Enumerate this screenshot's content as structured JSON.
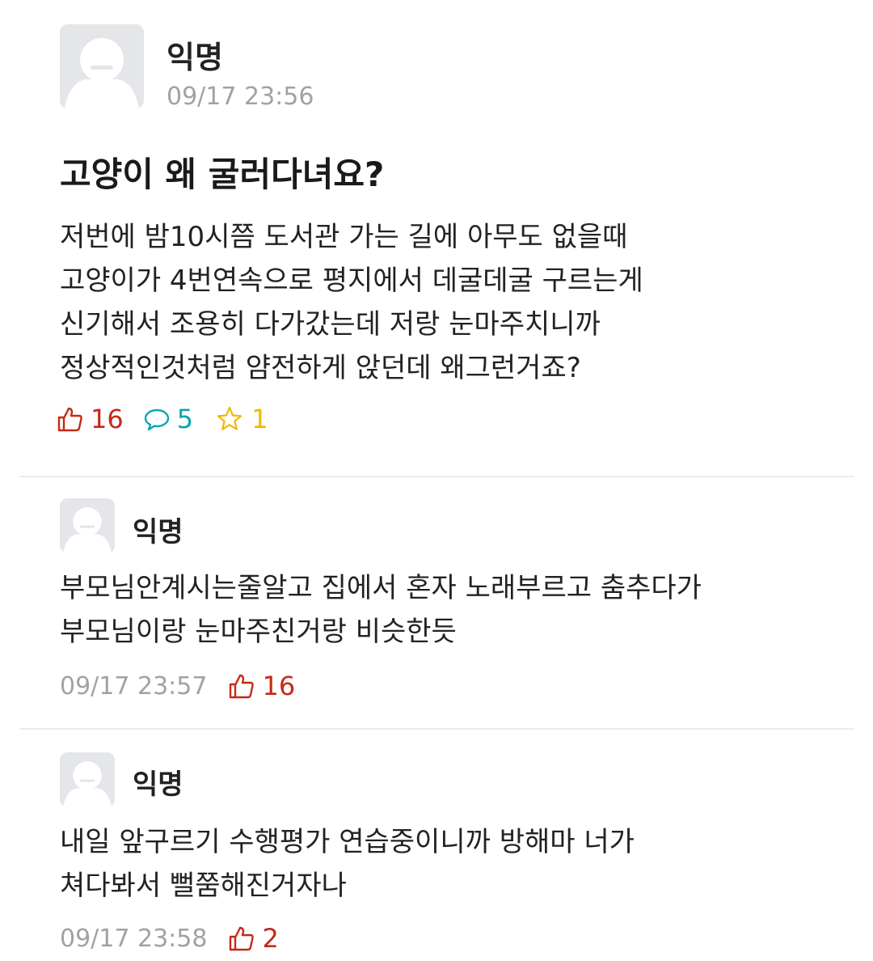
{
  "post": {
    "author": "익명",
    "time": "09/17 23:56",
    "title": "고양이 왜 굴러다녀요?",
    "body_lines": [
      "저번에 밤10시쯤 도서관 가는 길에 아무도 없을때",
      "고양이가 4번연속으로 평지에서 데굴데굴 구르는게",
      "신기해서 조용히 다가갔는데 저랑 눈마주치니까",
      "정상적인것처럼 얌전하게 앉던데 왜그런거죠?"
    ],
    "likes": "16",
    "comments": "5",
    "scraps": "1"
  },
  "comments": [
    {
      "author": "익명",
      "lines": [
        "부모님안계시는줄알고 집에서 혼자 노래부르고 춤추다가",
        "부모님이랑 눈마주친거랑 비슷한듯"
      ],
      "time": "09/17 23:57",
      "likes": "16"
    },
    {
      "author": "익명",
      "lines": [
        "내일 앞구르기 수행평가 연습중이니까 방해마 너가",
        "쳐다봐서 뻘쭘해진거자나"
      ],
      "time": "09/17 23:58",
      "likes": "2"
    }
  ],
  "colors": {
    "like": "#c62917",
    "comment": "#0ca5b0",
    "scrap": "#f2b600",
    "time": "#a2a2a2",
    "avatar_bg": "#e4e6e9"
  },
  "icons": {
    "like": "thumbs-up-icon",
    "comment": "speech-bubble-icon",
    "scrap": "star-icon",
    "avatar": "default-profile-icon"
  }
}
